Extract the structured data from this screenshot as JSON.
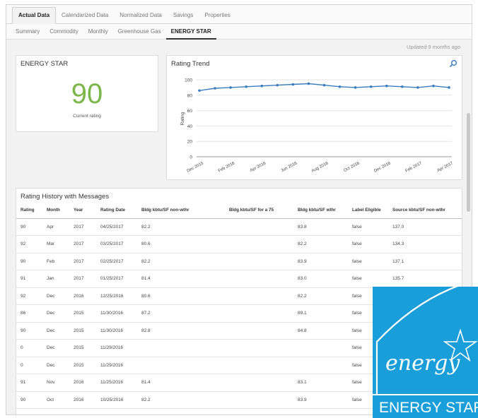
{
  "tabs_primary": [
    "Actual Data",
    "Calendarized Data",
    "Normalized Data",
    "Savings",
    "Properties"
  ],
  "tabs_secondary": [
    "Summary",
    "Commodity",
    "Monthly",
    "Greenhouse Gas",
    "ENERGY STAR"
  ],
  "updated_text": "Updated 9 months ago",
  "energy_star_card": {
    "title": "ENERGY STAR",
    "rating": "90",
    "rating_label": "Current rating"
  },
  "trend_card": {
    "title": "Rating Trend",
    "zoom_icon": "magnifier-icon"
  },
  "chart_data": {
    "type": "line",
    "title": "Rating Trend",
    "ylabel": "Rating",
    "xlabel": "",
    "ylim": [
      0,
      100
    ],
    "yticks": [
      0,
      20,
      40,
      60,
      80,
      100
    ],
    "x_tick_labels": [
      "Dec 2015",
      "Feb 2016",
      "Apr 2016",
      "Jun 2016",
      "Aug 2016",
      "Oct 2016",
      "Dec 2016",
      "Feb 2017",
      "Apr 2017"
    ],
    "x": [
      "Dec 2015",
      "Jan 2016",
      "Feb 2016",
      "Mar 2016",
      "Apr 2016",
      "May 2016",
      "Jun 2016",
      "Jul 2016",
      "Aug 2016",
      "Sep 2016",
      "Oct 2016",
      "Nov 2016",
      "Dec 2016",
      "Jan 2017",
      "Feb 2017",
      "Mar 2017",
      "Apr 2017"
    ],
    "values": [
      86,
      89,
      90,
      91,
      92,
      93,
      94,
      95,
      93,
      91,
      90,
      91,
      92,
      91,
      90,
      92,
      90
    ],
    "line_color": "#3a7dbf",
    "grid": "horizontal"
  },
  "history": {
    "title": "Rating History with Messages",
    "columns": [
      "Rating",
      "Month",
      "Year",
      "Rating Date",
      "Bldg kbtu/SF non-wthr",
      "Bldg kbtu/SF for a 75",
      "Bldg kbtu/SF wthr",
      "Label Eligible",
      "Source kbtu/SF non-wthr"
    ],
    "rows": [
      [
        "90",
        "Apr",
        "2017",
        "04/25/2017",
        "82.2",
        "",
        "83.8",
        "false",
        "137.0"
      ],
      [
        "92",
        "Mar",
        "2017",
        "03/25/2017",
        "80.6",
        "",
        "82.2",
        "false",
        "134.3"
      ],
      [
        "90",
        "Feb",
        "2017",
        "02/25/2017",
        "82.2",
        "",
        "83.9",
        "false",
        "137.1"
      ],
      [
        "91",
        "Jan",
        "2017",
        "01/25/2017",
        "81.4",
        "",
        "83.0",
        "false",
        "135.7"
      ],
      [
        "92",
        "Dec",
        "2016",
        "12/25/2016",
        "80.6",
        "",
        "82.2",
        "false",
        ""
      ],
      [
        "86",
        "Dec",
        "2015",
        "11/30/2016",
        "87.2",
        "",
        "89.1",
        "false",
        ""
      ],
      [
        "90",
        "Dec",
        "2015",
        "11/30/2016",
        "82.8",
        "",
        "84.8",
        "false",
        ""
      ],
      [
        "0",
        "Dec",
        "2015",
        "11/29/2016",
        "",
        "",
        "",
        "false",
        ""
      ],
      [
        "0",
        "Dec",
        "2015",
        "11/29/2016",
        "",
        "",
        "",
        "false",
        ""
      ],
      [
        "91",
        "Nov",
        "2016",
        "11/25/2016",
        "81.4",
        "",
        "83.1",
        "false",
        ""
      ],
      [
        "90",
        "Oct",
        "2016",
        "10/25/2016",
        "82.2",
        "",
        "83.9",
        "false",
        ""
      ]
    ]
  },
  "logo": {
    "script_text": "energy",
    "banner_text": "ENERGY STAR",
    "color": "#1a9ed9"
  },
  "colors": {
    "accent_green": "#7ab648",
    "line_blue": "#3a7dbf"
  }
}
